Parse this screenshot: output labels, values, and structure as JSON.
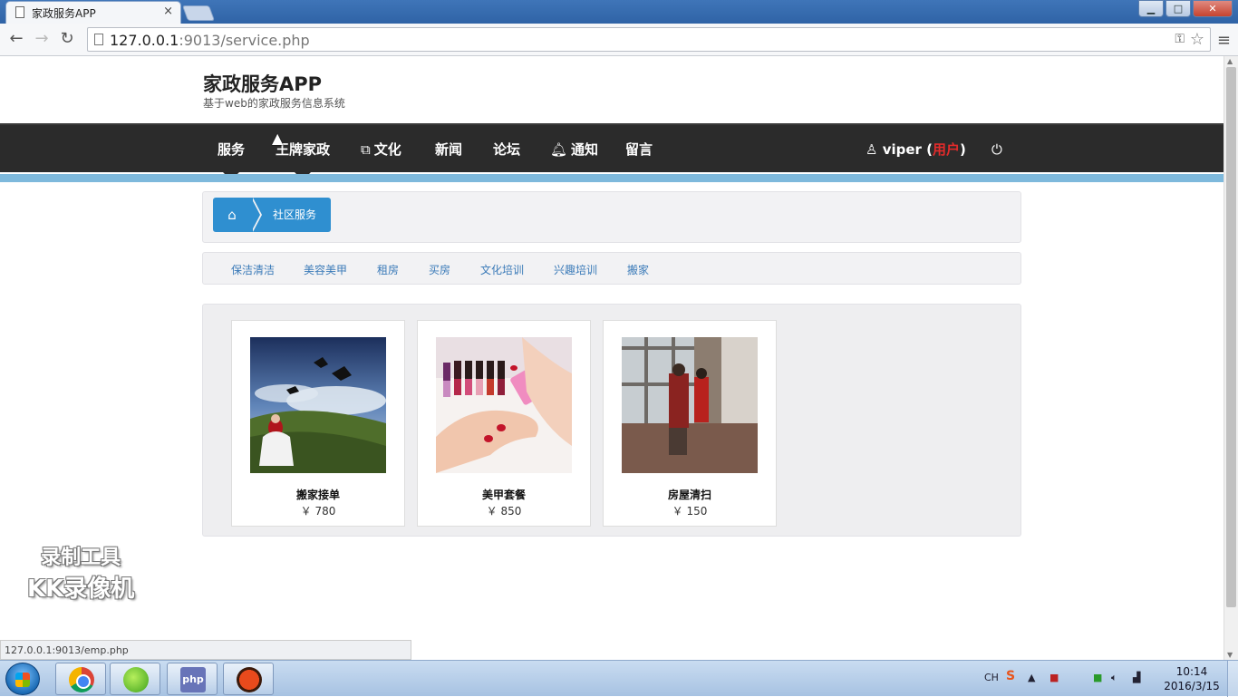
{
  "browser": {
    "tab_title": "家政服务APP",
    "tab_close": "×",
    "url_host": "127.0.0.1",
    "url_rest": ":9013/service.php",
    "status_link": "127.0.0.1:9013/emp.php",
    "window_buttons": {
      "minimize": "▁",
      "maximize": "□",
      "close": "✕"
    }
  },
  "site": {
    "title": "家政服务APP",
    "subtitle": "基于web的家政服务信息系统"
  },
  "nav": {
    "items": [
      {
        "label": "服务",
        "icon": ""
      },
      {
        "label": "王牌家政",
        "icon": ""
      },
      {
        "label": "文化",
        "icon": "external-link-icon"
      },
      {
        "label": "新闻",
        "icon": ""
      },
      {
        "label": "论坛",
        "icon": ""
      },
      {
        "label": "通知",
        "icon": "bell-icon"
      },
      {
        "label": "留言",
        "icon": ""
      }
    ],
    "user_name": "viper",
    "user_paren_open": " (",
    "user_badge": "用户",
    "user_paren_close": ")"
  },
  "breadcrumb": {
    "home_icon": "home-icon",
    "current": "社区服务"
  },
  "categories": [
    "保洁清洁",
    "美容美甲",
    "租房",
    "买房",
    "文化培训",
    "兴趣培训",
    "搬家"
  ],
  "services": [
    {
      "title": "搬家接单",
      "price": "￥ 780"
    },
    {
      "title": "美甲套餐",
      "price": "￥ 850"
    },
    {
      "title": "房屋清扫",
      "price": "￥ 150"
    }
  ],
  "watermark": {
    "line1": "录制工具",
    "line2": "KK录像机"
  },
  "taskbar": {
    "ime": "CH",
    "time": "10:14",
    "date": "2016/3/15"
  },
  "colors": {
    "navbar": "#2b2b2b",
    "nav_stripe": "#7eb9dc",
    "breadcrumb_accent": "#2f8fd0",
    "category_link": "#3a7ab8"
  }
}
